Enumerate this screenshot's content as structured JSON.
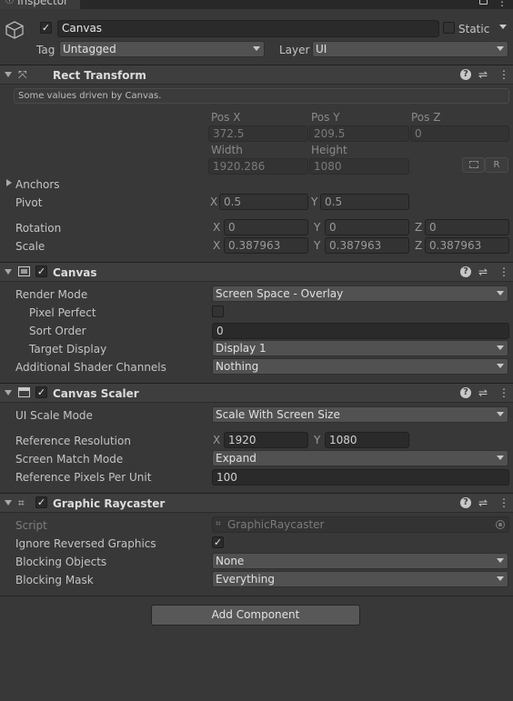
{
  "tab": {
    "title": "Inspector"
  },
  "object": {
    "name": "Canvas",
    "static_label": "Static",
    "tag_label": "Tag",
    "tag_value": "Untagged",
    "layer_label": "Layer",
    "layer_value": "UI"
  },
  "rect_transform": {
    "title": "Rect Transform",
    "note": "Some values driven by Canvas.",
    "pos_x_label": "Pos X",
    "pos_y_label": "Pos Y",
    "pos_z_label": "Pos Z",
    "pos_x": "372.5",
    "pos_y": "209.5",
    "pos_z": "0",
    "width_label": "Width",
    "height_label": "Height",
    "width": "1920.286",
    "height": "1080",
    "r_button": "R",
    "anchors_label": "Anchors",
    "pivot_label": "Pivot",
    "pivot_x": "0.5",
    "pivot_y": "0.5",
    "rotation_label": "Rotation",
    "rot_x": "0",
    "rot_y": "0",
    "rot_z": "0",
    "scale_label": "Scale",
    "scale_x": "0.387963",
    "scale_y": "0.387963",
    "scale_z": "0.387963",
    "x": "X",
    "y": "Y",
    "z": "Z"
  },
  "canvas": {
    "title": "Canvas",
    "render_mode_label": "Render Mode",
    "render_mode": "Screen Space - Overlay",
    "pixel_perfect_label": "Pixel Perfect",
    "sort_order_label": "Sort Order",
    "sort_order": "0",
    "target_display_label": "Target Display",
    "target_display": "Display 1",
    "shader_channels_label": "Additional Shader Channels",
    "shader_channels": "Nothing"
  },
  "canvas_scaler": {
    "title": "Canvas Scaler",
    "ui_scale_mode_label": "UI Scale Mode",
    "ui_scale_mode": "Scale With Screen Size",
    "ref_res_label": "Reference Resolution",
    "ref_x": "1920",
    "ref_y": "1080",
    "x": "X",
    "y": "Y",
    "match_mode_label": "Screen Match Mode",
    "match_mode": "Expand",
    "ppu_label": "Reference Pixels Per Unit",
    "ppu": "100"
  },
  "raycaster": {
    "title": "Graphic Raycaster",
    "script_label": "Script",
    "script": "GraphicRaycaster",
    "ignore_reversed_label": "Ignore Reversed Graphics",
    "blocking_objects_label": "Blocking Objects",
    "blocking_objects": "None",
    "blocking_mask_label": "Blocking Mask",
    "blocking_mask": "Everything"
  },
  "add_component": "Add Component",
  "icons": {
    "help": "?",
    "settings": "⇌",
    "more": "⋮",
    "check": "✓",
    "lock": "🔒"
  }
}
